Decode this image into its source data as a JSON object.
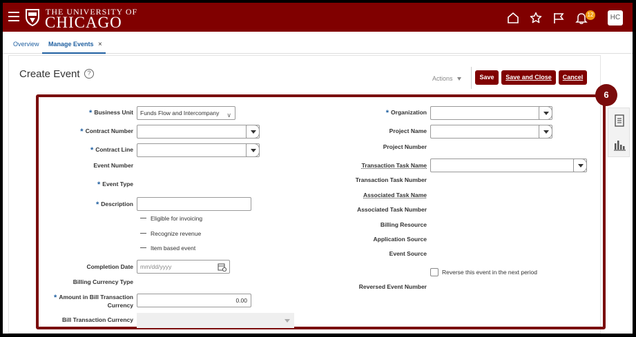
{
  "header": {
    "brand_top": "THE UNIVERSITY OF",
    "brand_main": "CHICAGO",
    "notification_count": "12",
    "user_initials": "HC",
    "colors": {
      "brand": "#800000",
      "badge": "#f39c12"
    },
    "icons": [
      "menu-icon",
      "home-icon",
      "star-icon",
      "flag-icon",
      "bell-icon"
    ]
  },
  "tabs": [
    {
      "label": "Overview"
    },
    {
      "label": "Manage Events",
      "close": "×"
    }
  ],
  "page": {
    "title": "Create Event",
    "help": "?",
    "actions_label": "Actions",
    "buttons": {
      "save": "Save",
      "save_close": "Save and Close",
      "cancel": "Cancel"
    },
    "step_number": "6"
  },
  "form": {
    "left": {
      "business_unit": {
        "label": "Business Unit",
        "value": "Funds Flow and Intercompany"
      },
      "contract_number": {
        "label": "Contract Number",
        "value": ""
      },
      "contract_line": {
        "label": "Contract Line",
        "value": ""
      },
      "event_number": {
        "label": "Event Number"
      },
      "event_type": {
        "label": "Event Type"
      },
      "description": {
        "label": "Description",
        "value": ""
      },
      "options": [
        "Eligible for invoicing",
        "Recognize revenue",
        "Item based event"
      ],
      "completion_date": {
        "label": "Completion Date",
        "placeholder": "mm/dd/yyyy"
      },
      "billing_currency_type": {
        "label": "Billing Currency Type"
      },
      "amount": {
        "label_line1": "Amount in Bill Transaction",
        "label_line2": "Currency",
        "value": "0.00"
      },
      "bill_transaction_currency": {
        "label": "Bill Transaction Currency"
      }
    },
    "right": {
      "organization": {
        "label": "Organization",
        "value": ""
      },
      "project_name": {
        "label": "Project Name",
        "value": ""
      },
      "project_number": {
        "label": "Project Number"
      },
      "transaction_task_name": {
        "label": "Transaction Task Name",
        "value": ""
      },
      "transaction_task_number": {
        "label": "Transaction Task Number"
      },
      "associated_task_name": {
        "label": "Associated Task Name"
      },
      "associated_task_number": {
        "label": "Associated Task Number"
      },
      "billing_resource": {
        "label": "Billing Resource"
      },
      "application_source": {
        "label": "Application Source"
      },
      "event_source": {
        "label": "Event Source"
      },
      "reverse_checkbox": {
        "label": "Reverse this event in the next period",
        "checked": false
      },
      "reversed_event_number": {
        "label": "Reversed Event Number"
      }
    },
    "required_marker": "*"
  }
}
